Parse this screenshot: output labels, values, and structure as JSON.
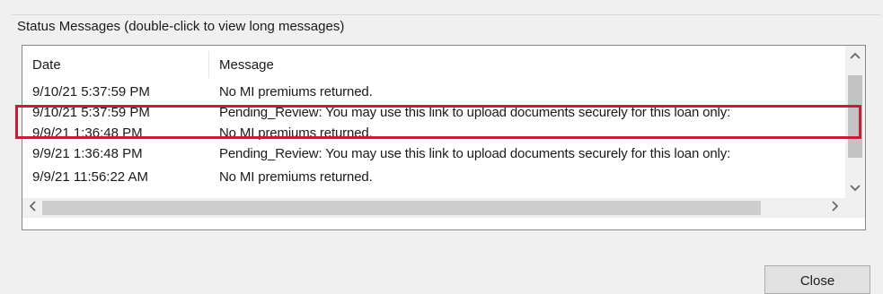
{
  "group": {
    "title": "Status Messages (double-click to view long messages)"
  },
  "list": {
    "columns": [
      "Date",
      "Message"
    ],
    "rows": [
      {
        "date": "9/10/21 5:37:59 PM",
        "message": "No MI premiums returned."
      },
      {
        "date": "9/10/21 5:37:59 PM",
        "message": "Pending_Review: You may use this link to upload documents securely for this loan only:"
      },
      {
        "date": "9/9/21 1:36:48 PM",
        "message": "No MI premiums returned."
      },
      {
        "date": "9/9/21 1:36:48 PM",
        "message": "Pending_Review: You may use this link to upload documents securely for this loan only:"
      },
      {
        "date": "9/9/21 11:56:22 AM",
        "message": "No MI premiums returned."
      }
    ],
    "highlighted_row_index": 1
  },
  "scrollbars": {
    "up_icon": "chevron-up-icon",
    "down_icon": "chevron-down-icon",
    "left_icon": "chevron-left-icon",
    "right_icon": "chevron-right-icon"
  },
  "buttons": {
    "close_label": "Close"
  },
  "colors": {
    "highlight_border": "#c0203a",
    "dialog_background": "#f0f0f0",
    "list_background": "#ffffff"
  }
}
